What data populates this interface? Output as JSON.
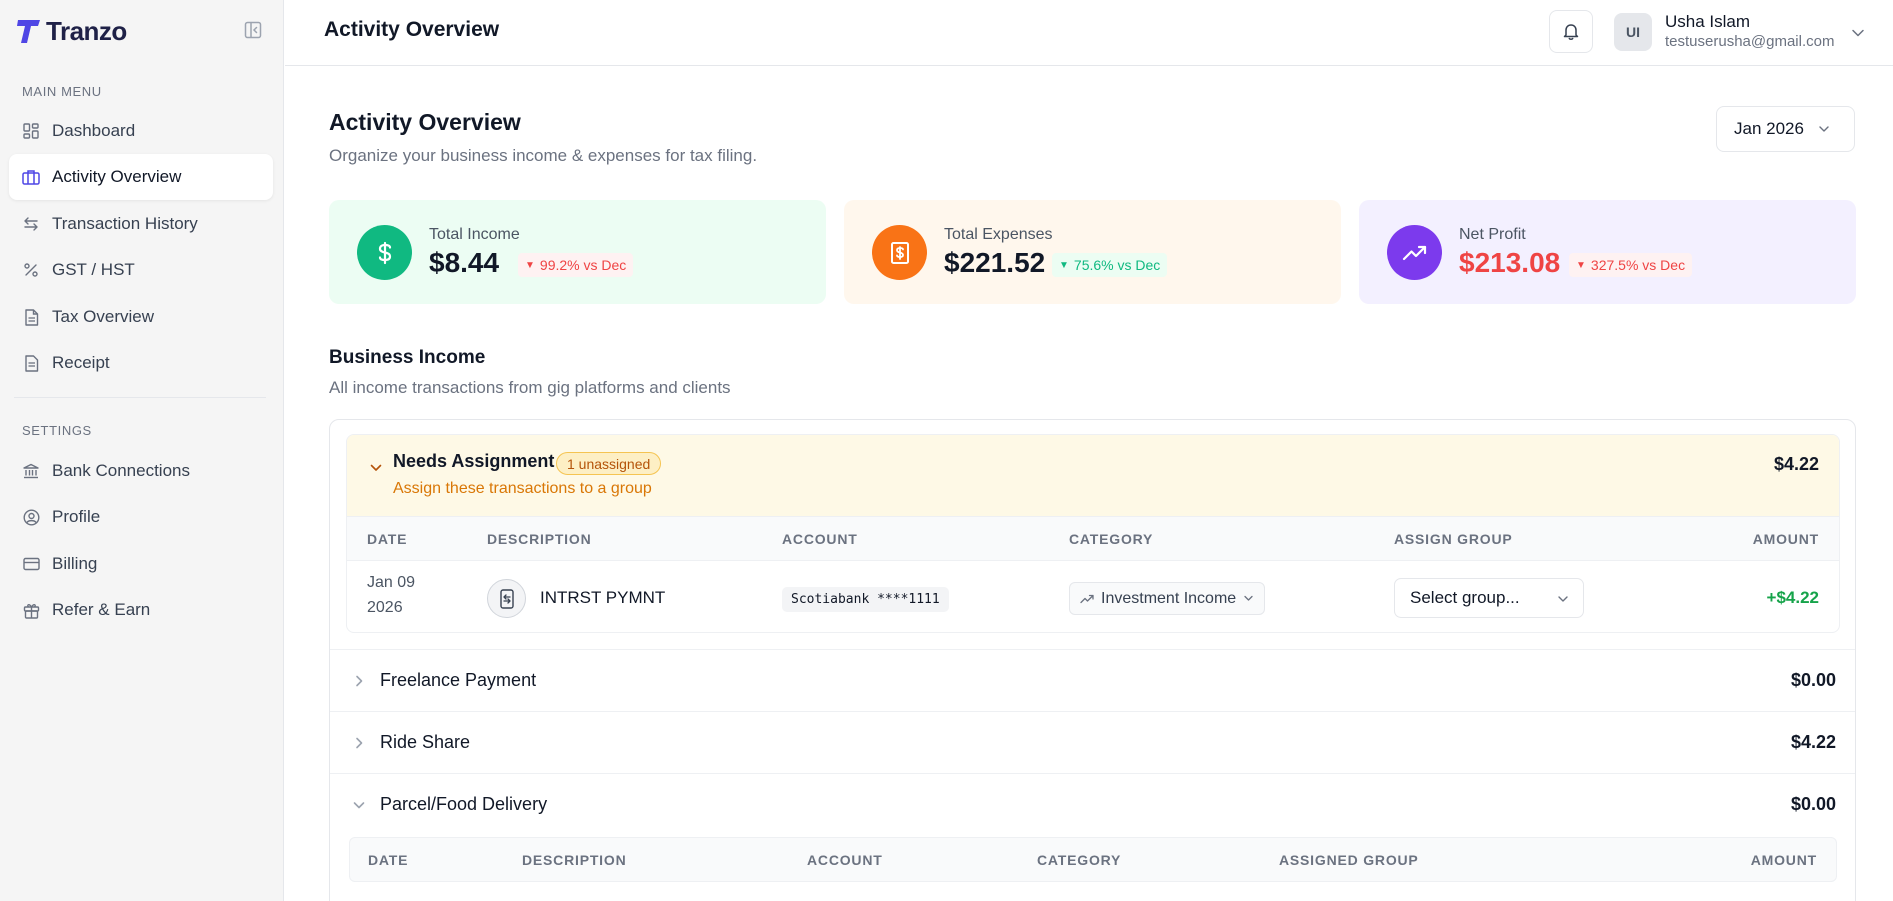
{
  "brand": {
    "name": "Tranzo"
  },
  "sidebar": {
    "main_menu_label": "MAIN MENU",
    "main_items": [
      {
        "label": "Dashboard",
        "icon": "dashboard-icon"
      },
      {
        "label": "Activity Overview",
        "icon": "briefcase-icon",
        "active": true
      },
      {
        "label": "Transaction History",
        "icon": "arrows-swap-icon"
      },
      {
        "label": "GST / HST",
        "icon": "percent-icon"
      },
      {
        "label": "Tax Overview",
        "icon": "document-icon"
      },
      {
        "label": "Receipt",
        "icon": "receipt-icon"
      }
    ],
    "settings_label": "SETTINGS",
    "settings_items": [
      {
        "label": "Bank Connections",
        "icon": "bank-icon"
      },
      {
        "label": "Profile",
        "icon": "user-circle-icon"
      },
      {
        "label": "Billing",
        "icon": "credit-card-icon"
      },
      {
        "label": "Refer & Earn",
        "icon": "gift-icon"
      }
    ]
  },
  "header": {
    "title": "Activity Overview",
    "user": {
      "initials": "UI",
      "name": "Usha Islam",
      "email": "testuserusha@gmail.com"
    }
  },
  "page": {
    "title": "Activity Overview",
    "subtitle": "Organize your business income & expenses for tax filing.",
    "month": "Jan 2026"
  },
  "stats": {
    "income": {
      "label": "Total Income",
      "value": "$8.44",
      "delta": "99.2% vs Dec",
      "trend": "down"
    },
    "expenses": {
      "label": "Total Expenses",
      "value": "$221.52",
      "delta": "75.6% vs Dec",
      "trend": "down"
    },
    "profit": {
      "label": "Net Profit",
      "value": "$213.08",
      "delta": "327.5% vs Dec",
      "trend": "down"
    }
  },
  "business_income": {
    "title": "Business Income",
    "subtitle": "All income transactions from gig platforms and clients",
    "needs_assignment": {
      "title": "Needs Assignment",
      "badge": "1 unassigned",
      "subtitle": "Assign these transactions to a group",
      "amount": "$4.22",
      "columns": [
        "DATE",
        "DESCRIPTION",
        "ACCOUNT",
        "CATEGORY",
        "ASSIGN GROUP",
        "AMOUNT"
      ],
      "rows": [
        {
          "date_line1": "Jan 09",
          "date_line2": "2026",
          "description": "INTRST PYMNT",
          "account": "Scotiabank ****1111",
          "category": "Investment Income",
          "group_placeholder": "Select group...",
          "amount": "+$4.22"
        }
      ]
    },
    "groups": [
      {
        "name": "Freelance Payment",
        "amount": "$0.00",
        "expanded": false
      },
      {
        "name": "Ride Share",
        "amount": "$4.22",
        "expanded": false
      },
      {
        "name": "Parcel/Food Delivery",
        "amount": "$0.00",
        "expanded": true
      }
    ],
    "group_columns": [
      "DATE",
      "DESCRIPTION",
      "ACCOUNT",
      "CATEGORY",
      "ASSIGNED GROUP",
      "AMOUNT"
    ]
  },
  "colors": {
    "accent": "#4f46e5",
    "income_bg": "#ecfdf3",
    "income_icon": "#10b981",
    "expense_bg": "#fff7ed",
    "expense_icon": "#f97316",
    "profit_bg": "#f3f0ff",
    "profit_icon": "#7c3aed",
    "negative": "#ef4444",
    "positive": "#16a34a"
  }
}
